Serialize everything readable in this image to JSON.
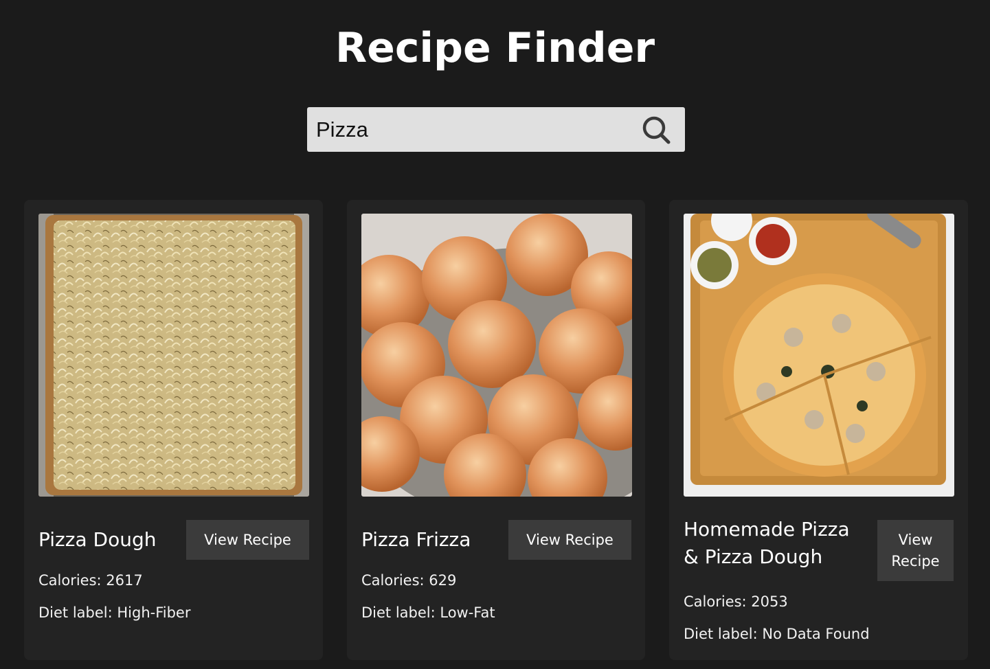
{
  "app": {
    "title": "Recipe Finder"
  },
  "search": {
    "value": "Pizza",
    "icon": "search-icon"
  },
  "recipes": [
    {
      "title": "Pizza Dough",
      "button_label": "View Recipe",
      "calories_text": "Calories: 2617",
      "diet_text": "Diet label: High-Fiber",
      "image": "onion-flatbread-photo"
    },
    {
      "title": "Pizza Frizza",
      "button_label": "View Recipe",
      "calories_text": "Calories: 629",
      "diet_text": "Diet label: Low-Fat",
      "image": "sugared-dough-balls-photo"
    },
    {
      "title": "Homemade Pizza & Pizza Dough",
      "button_label": "View Recipe",
      "calories_text": "Calories: 2053",
      "diet_text": "Diet label: No Data Found",
      "image": "mushroom-pizza-photo"
    }
  ],
  "colors": {
    "background": "#1b1b1b",
    "card": "#232323",
    "button": "#3b3b3b",
    "search_bg": "#e0e0e0"
  }
}
